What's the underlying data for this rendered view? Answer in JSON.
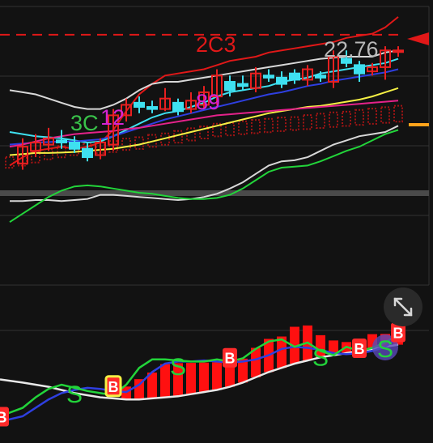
{
  "price_label": "22.76",
  "annotations": [
    {
      "text": "2C3",
      "color": "#e01818"
    },
    {
      "text": "3C",
      "color": "#39c24a"
    },
    {
      "text": "12",
      "color": "#d424d4"
    },
    {
      "text": "89",
      "color": "#d424d4"
    }
  ],
  "lower_markers": {
    "buy": "B",
    "sell": "S"
  },
  "colors": {
    "background": "#121212",
    "grid": "#333333",
    "up_candle": "#e82020",
    "down_candle": "#3ee0f0",
    "resistance_line": "#e01818",
    "price_tag": "#e01818",
    "orange_marker": "#ffa41b"
  },
  "expand_icon": "expand-arrows-icon",
  "chart_data": [
    {
      "type": "candlestick",
      "title": "",
      "xlabel": "",
      "ylabel": "",
      "grid": true,
      "candles": [
        {
          "o": 0,
          "c": 0,
          "h": 0,
          "l": 0
        },
        {
          "o": 17.3,
          "c": 18.1,
          "h": 18.5,
          "l": 17.0
        },
        {
          "o": 17.9,
          "c": 18.3,
          "h": 18.7,
          "l": 17.6
        },
        {
          "o": 18.2,
          "c": 18.5,
          "h": 19.0,
          "l": 17.9
        },
        {
          "o": 18.4,
          "c": 18.3,
          "h": 18.9,
          "l": 18.0
        },
        {
          "o": 18.3,
          "c": 18.0,
          "h": 18.6,
          "l": 17.8
        },
        {
          "o": 18.0,
          "c": 17.6,
          "h": 18.3,
          "l": 17.4
        },
        {
          "o": 17.7,
          "c": 18.3,
          "h": 18.5,
          "l": 17.5
        },
        {
          "o": 18.2,
          "c": 19.6,
          "h": 19.9,
          "l": 17.9
        },
        {
          "o": 19.6,
          "c": 20.1,
          "h": 20.4,
          "l": 19.3
        },
        {
          "o": 20.2,
          "c": 20.0,
          "h": 20.5,
          "l": 19.7
        },
        {
          "o": 20.0,
          "c": 19.9,
          "h": 20.3,
          "l": 19.7
        },
        {
          "o": 19.9,
          "c": 20.4,
          "h": 20.9,
          "l": 19.8
        },
        {
          "o": 20.2,
          "c": 19.8,
          "h": 20.4,
          "l": 19.6
        },
        {
          "o": 19.9,
          "c": 20.3,
          "h": 20.7,
          "l": 19.7
        },
        {
          "o": 20.1,
          "c": 20.7,
          "h": 21.0,
          "l": 19.9
        },
        {
          "o": 20.5,
          "c": 21.5,
          "h": 21.8,
          "l": 20.1
        },
        {
          "o": 21.2,
          "c": 20.8,
          "h": 21.5,
          "l": 20.5
        },
        {
          "o": 21.1,
          "c": 21.0,
          "h": 21.5,
          "l": 20.8
        },
        {
          "o": 20.9,
          "c": 21.6,
          "h": 21.9,
          "l": 20.7
        },
        {
          "o": 21.5,
          "c": 21.4,
          "h": 21.8,
          "l": 21.2
        },
        {
          "o": 21.4,
          "c": 21.1,
          "h": 21.7,
          "l": 20.9
        },
        {
          "o": 21.6,
          "c": 21.3,
          "h": 21.8,
          "l": 21.1
        },
        {
          "o": 21.3,
          "c": 21.8,
          "h": 22.0,
          "l": 21.0
        },
        {
          "o": 21.5,
          "c": 21.4,
          "h": 21.7,
          "l": 21.2
        },
        {
          "o": 21.2,
          "c": 22.4,
          "h": 22.7,
          "l": 20.9
        },
        {
          "o": 22.3,
          "c": 22.1,
          "h": 22.7,
          "l": 21.9
        },
        {
          "o": 22.0,
          "c": 21.6,
          "h": 22.2,
          "l": 21.2
        },
        {
          "o": 21.7,
          "c": 21.9,
          "h": 22.1,
          "l": 21.5
        },
        {
          "o": 21.9,
          "c": 22.7,
          "h": 22.9,
          "l": 21.3
        },
        {
          "o": 22.7,
          "c": 22.7,
          "h": 22.9,
          "l": 22.4
        }
      ],
      "series": [
        {
          "key": "bb_upper",
          "color": "#e01818",
          "values": [
            17.2,
            17.6,
            17.9,
            18.0,
            18.1,
            18.0,
            18.1,
            18.3,
            18.9,
            19.8,
            20.6,
            21.1,
            21.5,
            21.6,
            21.7,
            21.8,
            22.0,
            22.2,
            22.3,
            22.4,
            22.6,
            22.7,
            22.8,
            22.9,
            23.0,
            23.1,
            23.3,
            23.4,
            23.5,
            23.8,
            24.3
          ]
        },
        {
          "key": "bb_mid",
          "color": "#d8d8d8",
          "values": [
            20.8,
            20.7,
            20.6,
            20.4,
            20.2,
            20.0,
            19.9,
            19.9,
            20.1,
            20.4,
            20.8,
            21.1,
            21.2,
            21.2,
            21.3,
            21.4,
            21.5,
            21.6,
            21.7,
            21.8,
            21.9,
            22.0,
            22.1,
            22.2,
            22.3,
            22.35,
            22.4,
            22.4,
            22.4,
            22.6,
            22.7
          ]
        },
        {
          "key": "ma_cyan",
          "color": "#3ee0f0",
          "values": [
            18.8,
            18.7,
            18.6,
            18.55,
            18.5,
            18.4,
            18.3,
            18.35,
            18.6,
            18.9,
            19.2,
            19.5,
            19.7,
            19.8,
            20.0,
            20.2,
            20.5,
            20.7,
            20.8,
            20.9,
            21.0,
            21.2,
            21.3,
            21.4,
            21.6,
            21.7,
            21.8,
            21.9,
            22.0,
            22.1,
            22.3
          ]
        },
        {
          "key": "ma_blue",
          "color": "#2e3fe0",
          "values": [
            18.2,
            18.25,
            18.3,
            18.32,
            18.35,
            18.35,
            18.4,
            18.45,
            18.6,
            18.8,
            19.0,
            19.2,
            19.4,
            19.55,
            19.7,
            19.85,
            20.0,
            20.15,
            20.3,
            20.45,
            20.6,
            20.7,
            20.85,
            21.0,
            21.1,
            21.25,
            21.35,
            21.45,
            21.55,
            21.65,
            21.8
          ]
        },
        {
          "key": "ma_yellow",
          "color": "#f5f044",
          "values": [
            17.7,
            17.75,
            17.8,
            17.8,
            17.82,
            17.85,
            17.9,
            17.95,
            18.0,
            18.1,
            18.2,
            18.35,
            18.5,
            18.65,
            18.8,
            18.95,
            19.1,
            19.25,
            19.4,
            19.55,
            19.7,
            19.8,
            19.9,
            20.0,
            20.05,
            20.15,
            20.25,
            20.35,
            20.5,
            20.7,
            20.9
          ]
        },
        {
          "key": "ma_magenta",
          "color": "#e4228a",
          "values": [
            18.1,
            18.2,
            18.35,
            18.5,
            18.6,
            18.7,
            18.75,
            18.8,
            18.85,
            18.95,
            19.0,
            19.1,
            19.2,
            19.3,
            19.4,
            19.5,
            19.6,
            19.65,
            19.7,
            19.75,
            19.8,
            19.85,
            19.9,
            19.95,
            20.0,
            20.05,
            20.1,
            20.15,
            20.2,
            20.25,
            20.3
          ]
        },
        {
          "key": "bb_lower",
          "color": "#d8d8d8",
          "values": [
            15.5,
            15.5,
            15.55,
            15.55,
            15.5,
            15.55,
            15.6,
            15.8,
            15.8,
            15.75,
            15.7,
            15.65,
            15.6,
            15.55,
            15.6,
            15.7,
            15.85,
            16.1,
            16.4,
            16.8,
            17.2,
            17.4,
            17.45,
            17.6,
            17.9,
            18.2,
            18.4,
            18.6,
            18.7,
            18.8,
            19.1
          ]
        },
        {
          "key": "ma_green",
          "color": "#22d43a",
          "values": [
            14.5,
            14.9,
            15.3,
            15.7,
            16.0,
            16.2,
            16.25,
            16.2,
            16.1,
            16.0,
            15.9,
            15.85,
            15.75,
            15.65,
            15.6,
            15.6,
            15.65,
            15.8,
            16.1,
            16.5,
            16.9,
            17.1,
            17.15,
            17.2,
            17.4,
            17.65,
            17.9,
            18.1,
            18.4,
            18.7,
            18.9
          ]
        }
      ],
      "resistance_level": 23.45,
      "ylim": [
        13.5,
        24.8
      ],
      "volume": [
        0.8,
        0.7,
        0.9,
        0.6,
        1.0,
        0.8,
        0.7,
        0.9,
        0.9,
        1.0,
        1.1,
        1.2,
        1.0,
        1.1,
        1.3,
        1.2,
        1.4,
        1.3,
        1.5,
        1.6,
        1.6,
        1.7,
        1.5,
        1.8,
        1.9,
        2.0,
        1.9,
        2.1,
        2.2,
        2.3,
        2.4
      ]
    },
    {
      "type": "bar",
      "title": "",
      "grid": false,
      "bars": [
        0,
        0,
        0,
        0,
        0,
        0,
        0,
        0,
        0,
        0.35,
        0.55,
        0.7,
        0.9,
        0.9,
        0.85,
        0.8,
        0.75,
        0.6,
        0.65,
        0.8,
        0.9,
        0.85,
        1.0,
        0.95,
        0.6,
        0.4,
        0.3,
        0.3,
        0.4,
        0.35,
        0.2
      ],
      "series": [
        {
          "key": "white",
          "color": "#e8e8e8",
          "values": [
            0.55,
            0.52,
            0.5,
            0.48,
            0.45,
            0.42,
            0.4,
            0.38,
            0.37,
            0.36,
            0.36,
            0.37,
            0.38,
            0.39,
            0.41,
            0.43,
            0.45,
            0.48,
            0.52,
            0.57,
            0.62,
            0.66,
            0.7,
            0.73,
            0.76,
            0.78,
            0.8,
            0.82,
            0.84,
            0.86,
            0.88
          ]
        },
        {
          "key": "blue",
          "color": "#2e3fe0",
          "values": [
            0.15,
            0.2,
            0.28,
            0.36,
            0.42,
            0.45,
            0.47,
            0.46,
            0.44,
            0.43,
            0.5,
            0.62,
            0.7,
            0.72,
            0.72,
            0.73,
            0.72,
            0.71,
            0.72,
            0.74,
            0.78,
            0.84,
            0.86,
            0.85,
            0.83,
            0.8,
            0.79,
            0.8,
            0.82,
            0.86,
            0.95
          ]
        },
        {
          "key": "green",
          "color": "#22d43a",
          "values": [
            0.2,
            0.28,
            0.38,
            0.46,
            0.5,
            0.47,
            0.44,
            0.42,
            0.4,
            0.5,
            0.66,
            0.74,
            0.74,
            0.73,
            0.72,
            0.72,
            0.74,
            0.72,
            0.75,
            0.84,
            0.91,
            0.93,
            0.86,
            0.9,
            0.82,
            0.78,
            0.86,
            0.82,
            0.85,
            0.9,
            0.98
          ]
        }
      ],
      "markers": [
        {
          "i": 0,
          "kind": "buy",
          "style": "red"
        },
        {
          "i": 5,
          "kind": "sell",
          "style": "green"
        },
        {
          "i": 8,
          "kind": "buy",
          "style": "yellow"
        },
        {
          "i": 13,
          "kind": "sell",
          "style": "green"
        },
        {
          "i": 17,
          "kind": "buy",
          "style": "red"
        },
        {
          "i": 24,
          "kind": "sell",
          "style": "green"
        },
        {
          "i": 27,
          "kind": "buy",
          "style": "red"
        },
        {
          "i": 29,
          "kind": "sell",
          "style": "purple"
        },
        {
          "i": 30,
          "kind": "buy",
          "style": "red"
        }
      ]
    }
  ]
}
